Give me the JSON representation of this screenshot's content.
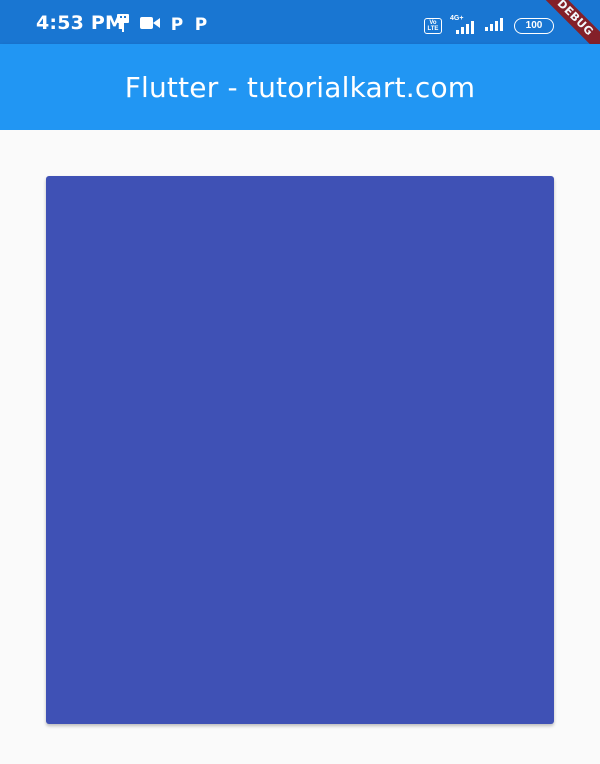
{
  "status_bar": {
    "time": "4:53 PM",
    "left_icons": [
      "usb-icon",
      "video-camera-icon",
      "p-icon",
      "p-icon"
    ],
    "p_label": "P",
    "volte_label": "Vo LTE",
    "network_label": "4G+",
    "battery_level": "100",
    "background_color": "#1976d2"
  },
  "debug_banner": {
    "label": "DEBUG",
    "color": "#8a1c21"
  },
  "app_bar": {
    "title": "Flutter - tutorialkart.com",
    "background_color": "#2196f3"
  },
  "content": {
    "container_color": "#3f51b5",
    "background_color": "#fafafa"
  }
}
